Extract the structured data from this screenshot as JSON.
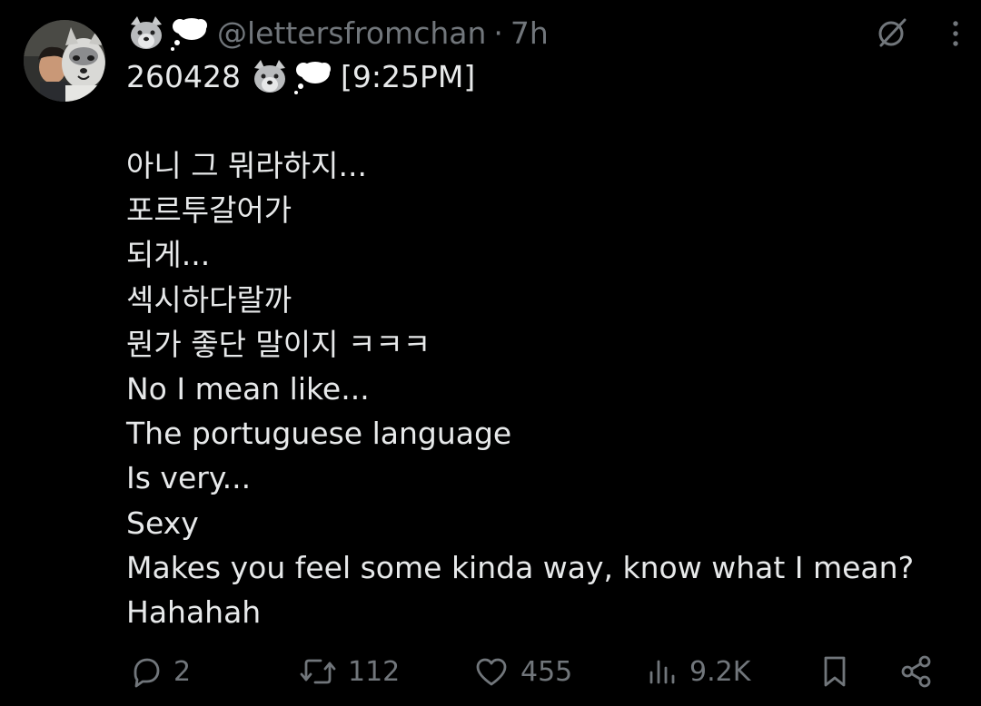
{
  "post": {
    "handle": "@lettersfromchan",
    "separator": "·",
    "time": "7h",
    "date_code": "260428",
    "timestamp": "[9:25PM]",
    "emoji": [
      "wolf-emoji",
      "thought-bubble-emoji"
    ],
    "body_lines": [
      "아니 그 뭐라하지...",
      "포르투갈어가",
      "되게...",
      "섹시하다랄까",
      "뭔가 좋단 말이지 ㅋㅋㅋ",
      "No I mean like...",
      "The portuguese language",
      "Is very...",
      "Sexy",
      "Makes you feel some kinda way, know what I mean?",
      "Hahahah"
    ]
  },
  "actions": {
    "replies": "2",
    "reposts": "112",
    "likes": "455",
    "views": "9.2K"
  },
  "icons": {
    "grok": "grok-icon",
    "more": "more-icon",
    "reply": "reply-icon",
    "repost": "repost-icon",
    "like": "like-icon",
    "views": "views-icon",
    "bookmark": "bookmark-icon",
    "share": "share-icon"
  },
  "colors": {
    "background": "#000000",
    "text_primary": "#e7e9ea",
    "text_secondary": "#71767b"
  }
}
